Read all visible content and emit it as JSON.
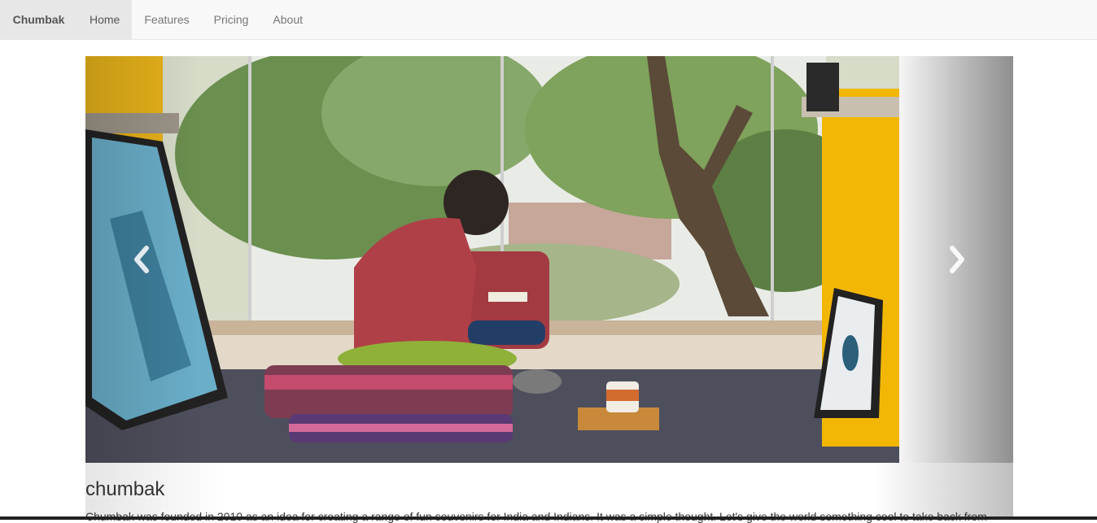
{
  "navbar": {
    "brand": "Chumbak",
    "items": [
      {
        "label": "Home",
        "active": true
      },
      {
        "label": "Features",
        "active": false
      },
      {
        "label": "Pricing",
        "active": false
      },
      {
        "label": "About",
        "active": false
      }
    ]
  },
  "carousel": {
    "prev_icon": "chevron-left-icon",
    "next_icon": "chevron-right-icon"
  },
  "content": {
    "title": "chumbak",
    "description": "Chumbak was founded in 2010 as an idea for creating a range of fun souvenirs for India and Indians. It was a simple thought. Let's give the world something cool to take back from"
  },
  "colors": {
    "navbar_bg": "#f8f8f8",
    "active_bg": "#e7e7e7",
    "shelf_yellow": "#f2b705",
    "shirt_red": "#a33a42"
  }
}
